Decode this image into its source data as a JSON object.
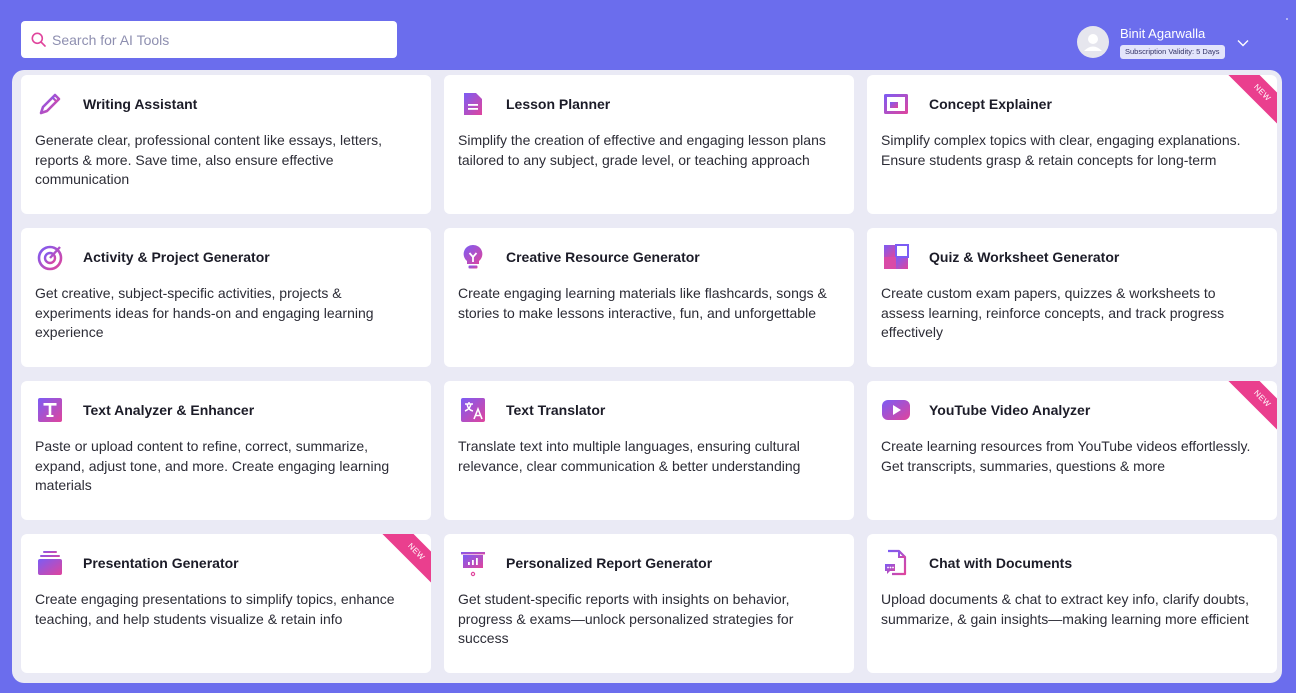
{
  "search": {
    "placeholder": "Search for AI Tools"
  },
  "user": {
    "name": "Binit Agarwalla",
    "validity": "Subscription Validity: 5 Days"
  },
  "cards": [
    {
      "title": "Writing Assistant",
      "desc": "Generate clear, professional content like essays, letters, reports & more. Save time, also ensure effective communication",
      "icon": "pencil-icon",
      "badge": ""
    },
    {
      "title": "Lesson Planner",
      "desc": "Simplify the creation of effective and engaging lesson plans tailored to any subject, grade level, or teaching approach",
      "icon": "document-icon",
      "badge": ""
    },
    {
      "title": "Concept Explainer",
      "desc": "Simplify complex topics with clear, engaging explanations. Ensure students grasp & retain concepts for long-term",
      "icon": "presentation-board-icon",
      "badge": "NEW"
    },
    {
      "title": "Activity & Project Generator",
      "desc": "Get creative, subject-specific activities, projects & experiments ideas for hands-on and engaging learning experience",
      "icon": "target-icon",
      "badge": ""
    },
    {
      "title": "Creative Resource Generator",
      "desc": "Create engaging learning materials like flashcards, songs & stories to make lessons interactive, fun, and unforgettable",
      "icon": "lightbulb-icon",
      "badge": ""
    },
    {
      "title": "Quiz & Worksheet Generator",
      "desc": "Create custom exam papers, quizzes & worksheets to assess learning, reinforce concepts, and track progress effectively",
      "icon": "quiz-grid-icon",
      "badge": ""
    },
    {
      "title": "Text Analyzer & Enhancer",
      "desc": "Paste or upload content to refine, correct, summarize, expand, adjust tone, and more. Create engaging learning materials",
      "icon": "text-t-icon",
      "badge": ""
    },
    {
      "title": "Text Translator",
      "desc": "Translate text into multiple languages, ensuring cultural relevance, clear communication & better understanding",
      "icon": "translate-icon",
      "badge": ""
    },
    {
      "title": "YouTube Video Analyzer",
      "desc": "Create learning resources from YouTube videos effortlessly. Get transcripts, summaries, questions & more",
      "icon": "play-video-icon",
      "badge": "NEW"
    },
    {
      "title": "Presentation Generator",
      "desc": "Create engaging presentations to simplify topics, enhance teaching, and help students visualize & retain info",
      "icon": "slides-stack-icon",
      "badge": "NEW"
    },
    {
      "title": "Personalized Report Generator",
      "desc": "Get student-specific reports with insights on behavior, progress & exams—unlock personalized strategies for success",
      "icon": "report-chart-icon",
      "badge": ""
    },
    {
      "title": "Chat with Documents",
      "desc": "Upload documents & chat to extract key info, clarify doubts, summarize, & gain insights—making learning more efficient",
      "icon": "chat-document-icon",
      "badge": ""
    }
  ],
  "colors": {
    "header": "#6b6ded",
    "accent_start": "#7b5cf5",
    "accent_end": "#e0449c",
    "badge": "#ea3f8e"
  }
}
